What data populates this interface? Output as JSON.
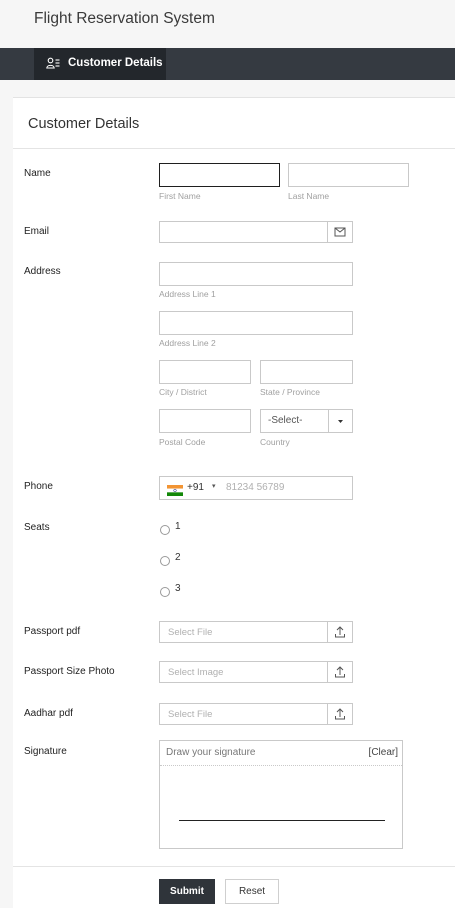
{
  "app": {
    "title": "Flight Reservation System"
  },
  "nav": {
    "tab_label": "Customer Details"
  },
  "form": {
    "title": "Customer Details",
    "name": {
      "label": "Name",
      "first_sub": "First Name",
      "last_sub": "Last Name"
    },
    "email": {
      "label": "Email"
    },
    "address": {
      "label": "Address",
      "line1_sub": "Address Line 1",
      "line2_sub": "Address Line 2",
      "city_sub": "City / District",
      "state_sub": "State / Province",
      "postal_sub": "Postal Code",
      "country_sub": "Country",
      "country_value": "-Select-"
    },
    "phone": {
      "label": "Phone",
      "code": "+91",
      "placeholder": "81234 56789"
    },
    "seats": {
      "label": "Seats",
      "options": [
        "1",
        "2",
        "3"
      ]
    },
    "passport_pdf": {
      "label": "Passport pdf",
      "placeholder": "Select File"
    },
    "passport_photo": {
      "label": "Passport Size Photo",
      "placeholder": "Select Image"
    },
    "aadhar_pdf": {
      "label": "Aadhar pdf",
      "placeholder": "Select File"
    },
    "signature": {
      "label": "Signature",
      "placeholder": "Draw your signature",
      "clear_label": "[Clear]"
    },
    "submit_label": "Submit",
    "reset_label": "Reset"
  },
  "icons": {
    "nav": "user-list-icon",
    "email": "envelope-icon",
    "country": "caret-down-icon",
    "phone_flag": "india-flag-icon",
    "upload": "upload-icon"
  },
  "colors": {
    "navbar": "#353a41",
    "active_tab": "#23272c",
    "submit": "#2f343a",
    "flag_saffron": "#f29433",
    "flag_green": "#138808"
  }
}
